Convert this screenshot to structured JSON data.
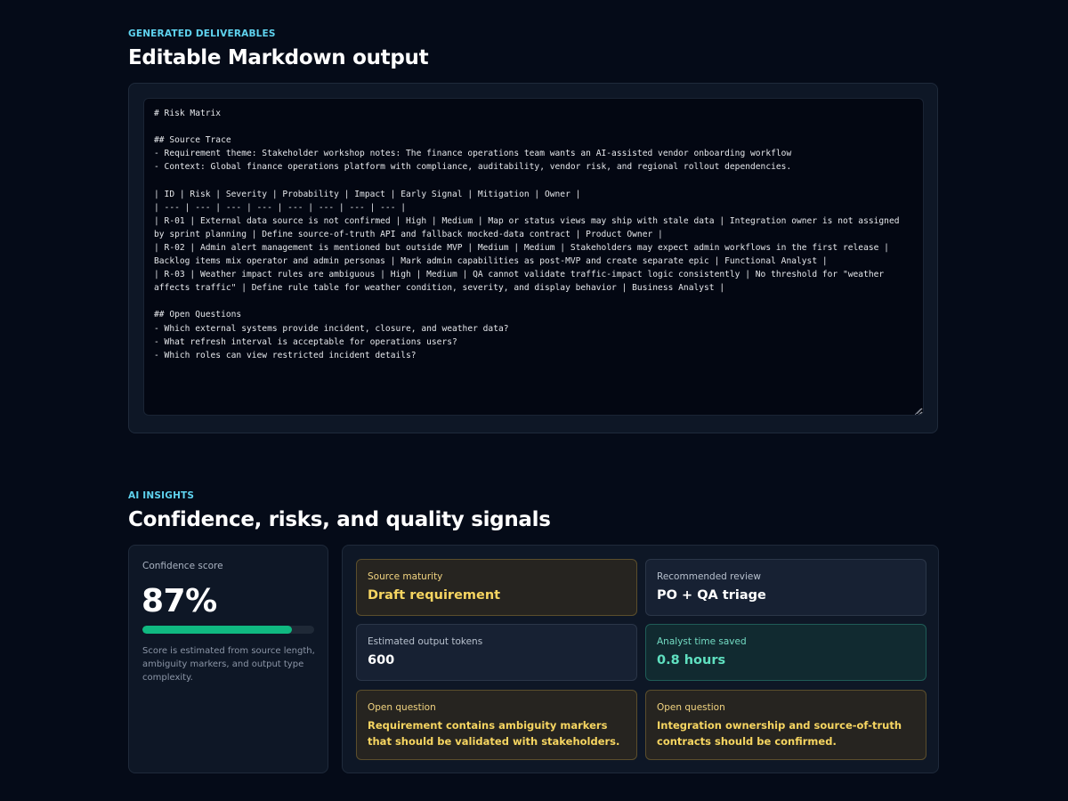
{
  "deliverables": {
    "eyebrow": "GENERATED DELIVERABLES",
    "title": "Editable Markdown output",
    "markdown": "# Risk Matrix\n\n## Source Trace\n- Requirement theme: Stakeholder workshop notes: The finance operations team wants an AI-assisted vendor onboarding workflow\n- Context: Global finance operations platform with compliance, auditability, vendor risk, and regional rollout dependencies.\n\n| ID | Risk | Severity | Probability | Impact | Early Signal | Mitigation | Owner |\n| --- | --- | --- | --- | --- | --- | --- | --- |\n| R-01 | External data source is not confirmed | High | Medium | Map or status views may ship with stale data | Integration owner is not assigned by sprint planning | Define source-of-truth API and fallback mocked-data contract | Product Owner |\n| R-02 | Admin alert management is mentioned but outside MVP | Medium | Medium | Stakeholders may expect admin workflows in the first release | Backlog items mix operator and admin personas | Mark admin capabilities as post-MVP and create separate epic | Functional Analyst |\n| R-03 | Weather impact rules are ambiguous | High | Medium | QA cannot validate traffic-impact logic consistently | No threshold for \"weather affects traffic\" | Define rule table for weather condition, severity, and display behavior | Business Analyst |\n\n## Open Questions\n- Which external systems provide incident, closure, and weather data?\n- What refresh interval is acceptable for operations users?\n- Which roles can view restricted incident details?"
  },
  "insights": {
    "eyebrow": "AI INSIGHTS",
    "title": "Confidence, risks, and quality signals",
    "confidence": {
      "label": "Confidence score",
      "value": "87%",
      "progress": 0.87,
      "note": "Score is estimated from source length, ambiguity markers, and output type complexity."
    },
    "signals": [
      {
        "label": "Source maturity",
        "value": "Draft requirement",
        "tone": "warn"
      },
      {
        "label": "Recommended review",
        "value": "PO + QA triage",
        "tone": "neutral"
      },
      {
        "label": "Estimated output tokens",
        "value": "600",
        "tone": "neutral"
      },
      {
        "label": "Analyst time saved",
        "value": "0.8 hours",
        "tone": "success"
      },
      {
        "label": "Open question",
        "value": "Requirement contains ambiguity markers that should be validated with stakeholders.",
        "tone": "warn"
      },
      {
        "label": "Open question",
        "value": "Integration ownership and source-of-truth contracts should be confirmed.",
        "tone": "warn"
      }
    ]
  },
  "colors": {
    "background": "#050b18",
    "accent_eyebrow": "#5fd3ef",
    "progress": "#10b981",
    "warn_text": "#f6d561",
    "success_text": "#5fe0c0"
  }
}
